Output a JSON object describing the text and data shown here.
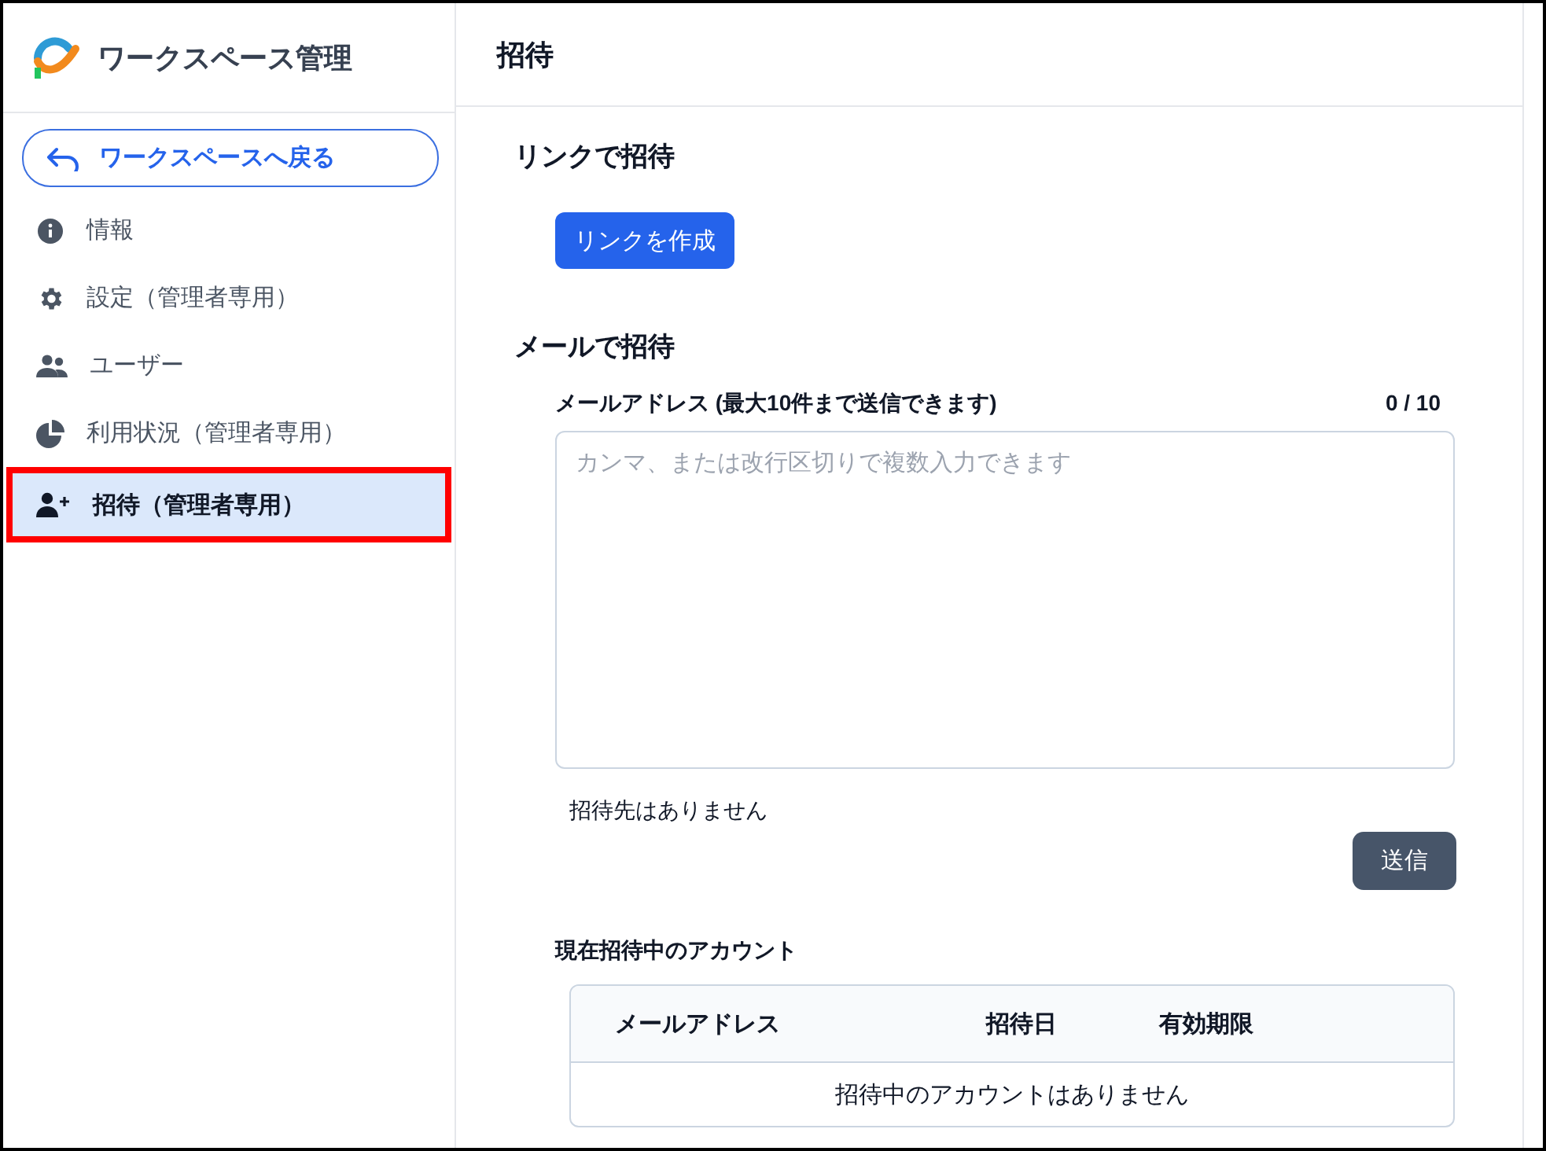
{
  "sidebar": {
    "title": "ワークスペース管理",
    "back_button": "ワークスペースへ戻る",
    "items": [
      {
        "label": "情報",
        "selected": false
      },
      {
        "label": "設定（管理者専用）",
        "selected": false
      },
      {
        "label": "ユーザー",
        "selected": false
      },
      {
        "label": "利用状況（管理者専用）",
        "selected": false
      },
      {
        "label": "招待（管理者専用）",
        "selected": true
      }
    ]
  },
  "page_title": "招待",
  "link_section": {
    "heading": "リンクで招待",
    "button": "リンクを作成"
  },
  "mail_section": {
    "heading": "メールで招待",
    "field_label": "メールアドレス (最大10件まで送信できます)",
    "counter": "0 / 10",
    "placeholder": "カンマ、または改行区切りで複数入力できます",
    "status": "招待先はありません",
    "send_button": "送信"
  },
  "pending": {
    "heading": "現在招待中のアカウント",
    "columns": [
      "メールアドレス",
      "招待日",
      "有効期限"
    ],
    "empty": "招待中のアカウントはありません"
  }
}
